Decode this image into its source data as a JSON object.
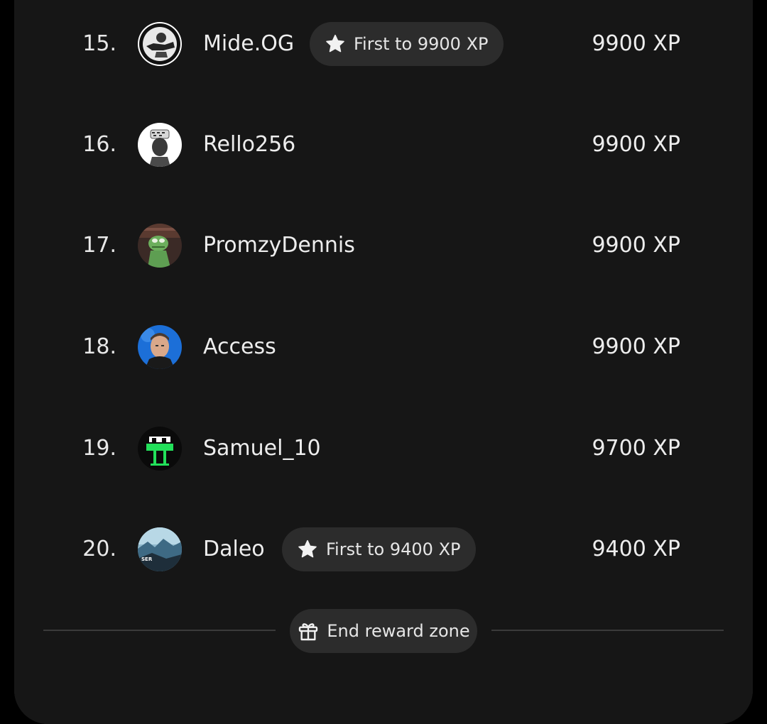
{
  "leaderboard": {
    "rows": [
      {
        "rank": "15.",
        "username": "Mide.OG",
        "xp": "9900 XP",
        "badge": "First to 9900 XP",
        "avatar": "avatar-bw-figure"
      },
      {
        "rank": "16.",
        "username": "Rello256",
        "xp": "9900 XP",
        "badge": null,
        "avatar": "avatar-masked-face"
      },
      {
        "rank": "17.",
        "username": "PromzyDennis",
        "xp": "9900 XP",
        "badge": null,
        "avatar": "avatar-green-frog"
      },
      {
        "rank": "18.",
        "username": "Access",
        "xp": "9900 XP",
        "badge": null,
        "avatar": "avatar-man-blue-bg"
      },
      {
        "rank": "19.",
        "username": "Samuel_10",
        "xp": "9700 XP",
        "badge": null,
        "avatar": "avatar-green-pixel-robot"
      },
      {
        "rank": "20.",
        "username": "Daleo",
        "xp": "9400 XP",
        "badge": "First to 9400 XP",
        "avatar": "avatar-blue-landscape",
        "avatar_text": "SER"
      }
    ]
  },
  "end_zone": {
    "label": "End reward zone",
    "icon": "gift-icon"
  },
  "colors": {
    "panel_bg": "#161616",
    "pill_bg": "#2c2c2c",
    "text": "#ededed",
    "divider": "#3a3a3a"
  }
}
